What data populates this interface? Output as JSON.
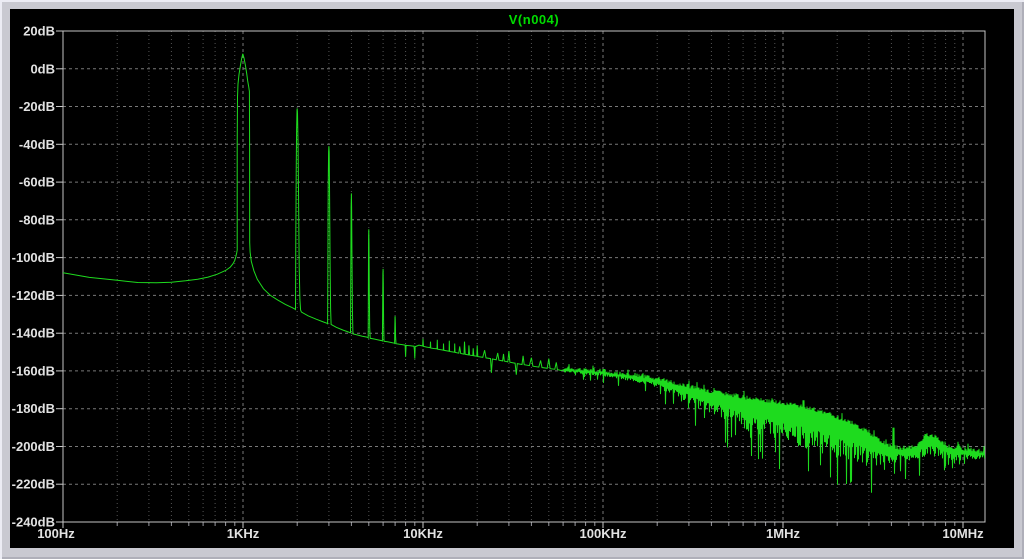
{
  "window": {
    "frame_color": "#C9C9D1",
    "client_bg": "#000000"
  },
  "chart_data": {
    "type": "line",
    "title": "V(n004)",
    "title_color": "#00DC00",
    "trace_color": "#1EDB1E",
    "grid_major_color": "#787878",
    "grid_minor_color": "#545454",
    "axis_box_color": "#C4C4C4",
    "label_color": "#E2E2E2",
    "tick_color": "#C8C8C8",
    "legend_position": "top-center",
    "grid": "dashed",
    "x_axis": {
      "scale": "log",
      "min_hz": 100,
      "max_hz": 13200000,
      "tick_hz": [
        100,
        1000,
        10000,
        100000,
        1000000,
        10000000
      ],
      "tick_labels": [
        "100Hz",
        "1KHz",
        "10KHz",
        "100KHz",
        "1MHz",
        "10MHz"
      ]
    },
    "y_axis": {
      "unit": "dB",
      "max_db": 20,
      "min_db": -240,
      "step_db": 20,
      "tick_labels": [
        "20dB",
        "0dB",
        "-20dB",
        "-40dB",
        "-60dB",
        "-80dB",
        "-100dB",
        "-120dB",
        "-140dB",
        "-160dB",
        "-180dB",
        "-200dB",
        "-220dB",
        "-240dB"
      ]
    },
    "series": [
      {
        "name": "V(n004)",
        "color": "#1EDB1E"
      }
    ],
    "harmonic_peaks_db": {
      "1kHz": 8,
      "2kHz": -21,
      "3kHz": -41,
      "4kHz": -66,
      "5kHz": -85,
      "6kHz": -106,
      "7kHz": -131
    },
    "line_points": [
      [
        100,
        -108
      ],
      [
        140,
        -110.5
      ],
      [
        200,
        -112
      ],
      [
        260,
        -113.2
      ],
      [
        330,
        -113.3
      ],
      [
        400,
        -113
      ],
      [
        480,
        -112.3
      ],
      [
        560,
        -111.5
      ],
      [
        640,
        -110.3
      ],
      [
        720,
        -108.8
      ],
      [
        800,
        -106.8
      ],
      [
        850,
        -105
      ],
      [
        880,
        -103.2
      ],
      [
        900,
        -101.5
      ],
      [
        912,
        -99.5
      ],
      [
        922,
        -97.5
      ],
      [
        928,
        -96
      ],
      [
        929,
        -40
      ],
      [
        932,
        -15
      ],
      [
        938,
        -8
      ],
      [
        950,
        -3
      ],
      [
        968,
        2
      ],
      [
        984,
        5.5
      ],
      [
        998,
        8
      ],
      [
        1014,
        5.5
      ],
      [
        1032,
        1.5
      ],
      [
        1048,
        -2.5
      ],
      [
        1062,
        -6.5
      ],
      [
        1076,
        -9.5
      ],
      [
        1086,
        -12
      ],
      [
        1088,
        -40
      ],
      [
        1090,
        -92
      ],
      [
        1095,
        -97
      ],
      [
        1112,
        -102
      ],
      [
        1150,
        -107
      ],
      [
        1200,
        -111.5
      ],
      [
        1300,
        -116.5
      ],
      [
        1420,
        -120
      ],
      [
        1560,
        -122.5
      ],
      [
        1720,
        -124.8
      ],
      [
        1880,
        -126.5
      ],
      [
        1948,
        -127.3
      ],
      [
        1958,
        -127.5
      ],
      [
        1966,
        -90
      ],
      [
        1974,
        -55
      ],
      [
        1984,
        -32
      ],
      [
        1995,
        -22
      ],
      [
        2000,
        -21
      ],
      [
        2009,
        -23.5
      ],
      [
        2020,
        -38
      ],
      [
        2036,
        -70
      ],
      [
        2052,
        -105
      ],
      [
        2070,
        -122
      ],
      [
        2088,
        -127.8
      ],
      [
        2110,
        -128.8
      ],
      [
        2300,
        -130.8
      ],
      [
        2550,
        -132.6
      ],
      [
        2800,
        -134.1
      ],
      [
        2932,
        -134.8
      ],
      [
        2950,
        -135
      ],
      [
        2962,
        -102
      ],
      [
        2975,
        -62
      ],
      [
        2988,
        -44
      ],
      [
        3000,
        -41
      ],
      [
        3011,
        -44
      ],
      [
        3026,
        -68
      ],
      [
        3046,
        -104
      ],
      [
        3066,
        -127
      ],
      [
        3088,
        -135.4
      ],
      [
        3300,
        -136.9
      ],
      [
        3600,
        -138.4
      ],
      [
        3850,
        -139.4
      ],
      [
        3944,
        -139.8
      ],
      [
        3958,
        -140
      ],
      [
        3971,
        -106
      ],
      [
        3986,
        -73
      ],
      [
        4000,
        -66
      ],
      [
        4013,
        -73
      ],
      [
        4031,
        -101
      ],
      [
        4052,
        -127
      ],
      [
        4080,
        -140.4
      ],
      [
        4300,
        -140.9
      ],
      [
        4600,
        -141.6
      ],
      [
        4880,
        -142.1
      ],
      [
        4944,
        -142.3
      ],
      [
        4958,
        -142.5
      ],
      [
        4973,
        -112
      ],
      [
        4988,
        -89
      ],
      [
        5000,
        -85
      ],
      [
        5013,
        -92
      ],
      [
        5033,
        -117
      ],
      [
        5057,
        -137
      ],
      [
        5090,
        -142.7
      ],
      [
        5350,
        -143.1
      ],
      [
        5700,
        -143.7
      ],
      [
        5928,
        -144
      ],
      [
        5950,
        -144.1
      ],
      [
        5969,
        -121
      ],
      [
        5988,
        -108.5
      ],
      [
        6000,
        -106
      ],
      [
        6015,
        -113
      ],
      [
        6039,
        -133
      ],
      [
        6070,
        -144.3
      ],
      [
        6350,
        -144.6
      ],
      [
        6700,
        -145
      ],
      [
        6930,
        -145.3
      ],
      [
        6950,
        -145.4
      ],
      [
        6971,
        -137.5
      ],
      [
        6990,
        -131.8
      ],
      [
        7000,
        -131
      ],
      [
        7014,
        -134.5
      ],
      [
        7040,
        -142
      ],
      [
        7076,
        -145.6
      ],
      [
        7400,
        -145.9
      ],
      [
        7800,
        -146.2
      ],
      [
        7950,
        -146.3
      ],
      [
        8000,
        -152.5
      ],
      [
        8052,
        -146.5
      ],
      [
        8500,
        -146.7
      ],
      [
        8918,
        -146.9
      ],
      [
        8958,
        -149
      ],
      [
        9000,
        -153.5
      ],
      [
        9052,
        -147.1
      ],
      [
        9500,
        -146.3
      ],
      [
        9960,
        -146.8
      ],
      [
        10000,
        -143
      ],
      [
        10050,
        -147
      ],
      [
        10500,
        -147.4
      ],
      [
        10960,
        -147.7
      ],
      [
        11000,
        -144.5
      ],
      [
        11050,
        -147.9
      ],
      [
        11500,
        -148.1
      ],
      [
        11960,
        -148.3
      ],
      [
        12000,
        -143.5
      ],
      [
        12050,
        -148.5
      ],
      [
        12600,
        -148.8
      ],
      [
        12960,
        -149
      ],
      [
        13000,
        -145.5
      ],
      [
        13050,
        -149.1
      ],
      [
        13600,
        -149.4
      ],
      [
        13960,
        -149.6
      ],
      [
        14000,
        -144
      ],
      [
        14050,
        -149.7
      ],
      [
        14700,
        -150
      ],
      [
        14960,
        -150.1
      ],
      [
        15000,
        -145.5
      ],
      [
        15050,
        -150.2
      ],
      [
        15800,
        -150.6
      ],
      [
        16000,
        -147
      ],
      [
        16200,
        -150.8
      ],
      [
        16900,
        -151.1
      ],
      [
        17000,
        -144.5
      ],
      [
        17150,
        -151.2
      ],
      [
        17900,
        -151.5
      ],
      [
        18000,
        -146.5
      ],
      [
        18150,
        -151.6
      ],
      [
        18900,
        -151.9
      ],
      [
        19000,
        -148
      ],
      [
        19150,
        -152
      ],
      [
        19900,
        -152.2
      ],
      [
        20000,
        -146.5
      ],
      [
        20150,
        -152.4
      ],
      [
        21500,
        -152.8
      ],
      [
        22000,
        -149
      ],
      [
        22400,
        -153.1
      ],
      [
        23700,
        -153.5
      ],
      [
        24000,
        -161
      ],
      [
        24300,
        -153.7
      ],
      [
        25500,
        -154.1
      ],
      [
        26000,
        -150.5
      ],
      [
        26400,
        -154.3
      ],
      [
        27700,
        -154.7
      ],
      [
        28000,
        -151
      ],
      [
        28300,
        -154.8
      ],
      [
        29600,
        -155.2
      ],
      [
        30000,
        -149.5
      ],
      [
        30400,
        -155.4
      ],
      [
        32500,
        -155.9
      ],
      [
        33000,
        -162
      ],
      [
        33400,
        -156.1
      ],
      [
        35500,
        -156.6
      ],
      [
        36000,
        -152
      ],
      [
        36500,
        -156.7
      ],
      [
        39000,
        -157.2
      ],
      [
        40000,
        -153
      ],
      [
        40800,
        -157.5
      ],
      [
        44000,
        -158
      ],
      [
        45000,
        -154.5
      ],
      [
        45800,
        -158.2
      ],
      [
        49000,
        -158.6
      ],
      [
        50000,
        -153.5
      ],
      [
        50800,
        -158.8
      ],
      [
        54000,
        -159.1
      ],
      [
        55000,
        -155.5
      ],
      [
        55800,
        -159.3
      ],
      [
        58500,
        -159.8
      ],
      [
        60000,
        -159.5
      ]
    ],
    "noise_start_hz": 60000,
    "noise_envelope": [
      [
        60000,
        -158,
        -161,
        -163.5
      ],
      [
        80000,
        -158.8,
        -162,
        -165
      ],
      [
        100000,
        -159.5,
        -163,
        -166.5
      ],
      [
        130000,
        -161,
        -165,
        -169
      ],
      [
        160000,
        -162,
        -166.5,
        -171
      ],
      [
        200000,
        -163.5,
        -169,
        -175
      ],
      [
        270000,
        -166.5,
        -175,
        -183
      ],
      [
        350000,
        -169.5,
        -181,
        -192
      ],
      [
        500000,
        -172,
        -187,
        -202
      ],
      [
        700000,
        -174.5,
        -194,
        -208
      ],
      [
        1000000,
        -176.5,
        -198,
        -213
      ],
      [
        1400000,
        -179,
        -202,
        -219
      ],
      [
        1900000,
        -183,
        -205.5,
        -224
      ],
      [
        2400000,
        -187,
        -208,
        -226
      ],
      [
        2900000,
        -191,
        -211,
        -227
      ],
      [
        3400000,
        -196,
        -210.5,
        -222
      ],
      [
        4000000,
        -199.5,
        -209,
        -217
      ],
      [
        4600000,
        -200.5,
        -207.5,
        -216
      ],
      [
        5100000,
        -200,
        -207,
        -221
      ],
      [
        5600000,
        -199,
        -206.5,
        -219
      ],
      [
        6200000,
        -193.5,
        -205,
        -216
      ],
      [
        7000000,
        -194.5,
        -205.5,
        -213
      ],
      [
        8000000,
        -199,
        -207,
        -213
      ],
      [
        9500000,
        -200.5,
        -207.5,
        -212
      ],
      [
        11000000,
        -201,
        -207,
        -210.5
      ],
      [
        13200000,
        -202.5,
        -206.5,
        -209
      ]
    ],
    "noise_spikes": [
      [
        4100000,
        -190
      ]
    ]
  }
}
